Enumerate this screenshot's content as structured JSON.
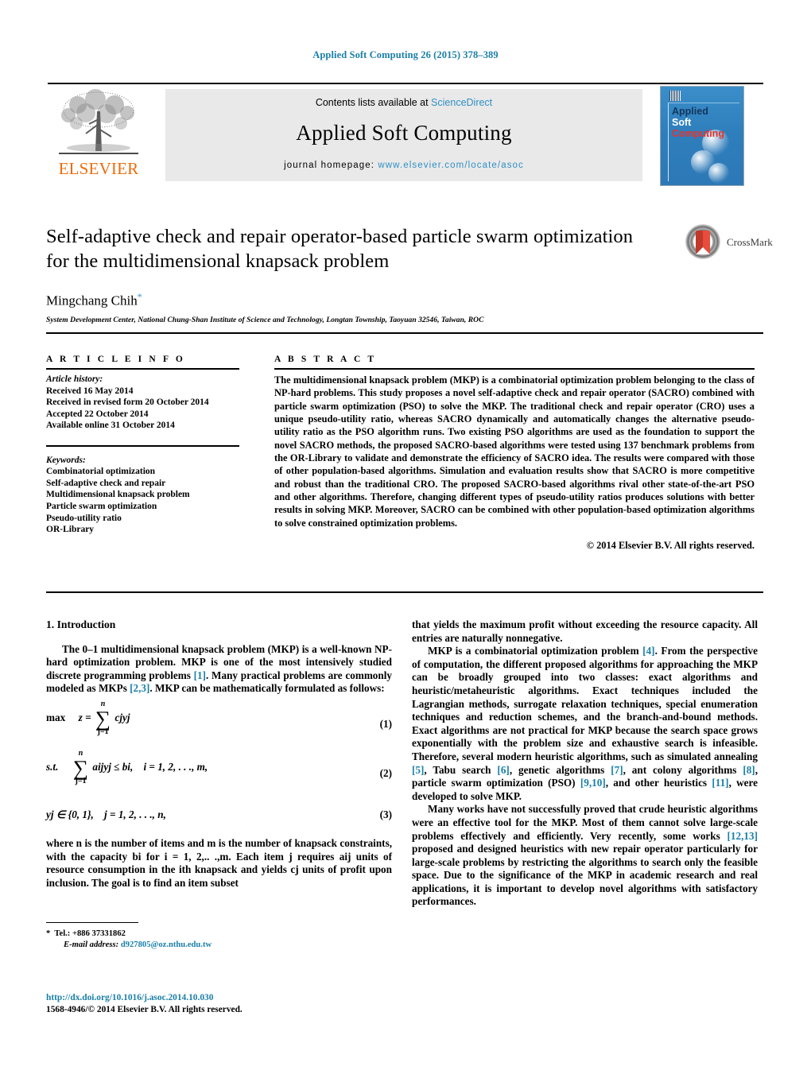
{
  "running_head": "Applied Soft Computing 26 (2015) 378–389",
  "masthead": {
    "publisher_name": "ELSEVIER",
    "contents_prefix": "Contents lists available at ",
    "contents_link": "ScienceDirect",
    "journal_title": "Applied Soft Computing",
    "homepage_prefix": "journal homepage:",
    "homepage_url": "www.elsevier.com/locate/asoc",
    "cover": {
      "line1": "Applied",
      "line2": "Soft",
      "line3": "Computing"
    }
  },
  "crossmark": {
    "label": "CrossMark"
  },
  "article": {
    "title": "Self-adaptive check and repair operator-based particle swarm optimization for the multidimensional knapsack problem",
    "author": "Mingchang Chih",
    "author_marker": "*",
    "affiliation": "System Development Center, National Chung-Shan Institute of Science and Technology, Longtan Township, Taoyuan 32546, Taiwan, ROC"
  },
  "article_info": {
    "heading": "A R T I C L E    I N F O",
    "history_label": "Article history:",
    "history": [
      "Received 16 May 2014",
      "Received in revised form 20 October 2014",
      "Accepted 22 October 2014",
      "Available online 31 October 2014"
    ],
    "keywords_label": "Keywords:",
    "keywords": [
      "Combinatorial optimization",
      "Self-adaptive check and repair",
      "Multidimensional knapsack problem",
      "Particle swarm optimization",
      "Pseudo-utility ratio",
      "OR-Library"
    ]
  },
  "abstract": {
    "heading": "A B S T R A C T",
    "body": "The multidimensional knapsack problem (MKP) is a combinatorial optimization problem belonging to the class of NP-hard problems. This study proposes a novel self-adaptive check and repair operator (SACRO) combined with particle swarm optimization (PSO) to solve the MKP. The traditional check and repair operator (CRO) uses a unique pseudo-utility ratio, whereas SACRO dynamically and automatically changes the alternative pseudo-utility ratio as the PSO algorithm runs. Two existing PSO algorithms are used as the foundation to support the novel SACRO methods, the proposed SACRO-based algorithms were tested using 137 benchmark problems from the OR-Library to validate and demonstrate the efficiency of SACRO idea. The results were compared with those of other population-based algorithms. Simulation and evaluation results show that SACRO is more competitive and robust than the traditional CRO. The proposed SACRO-based algorithms rival other state-of-the-art PSO and other algorithms. Therefore, changing different types of pseudo-utility ratios produces solutions with better results in solving MKP. Moreover, SACRO can be combined with other population-based optimization algorithms to solve constrained optimization problems.",
    "copyright": "© 2014 Elsevier B.V. All rights reserved."
  },
  "body": {
    "section_heading": "1.  Introduction",
    "left": {
      "para1_a": "The 0–1 multidimensional knapsack problem (MKP) is a well-known NP-hard optimization problem. MKP is one of the most intensively studied discrete programming problems ",
      "para1_ref1": "[1]",
      "para1_b": ". Many practical problems are commonly modeled as MKPs ",
      "para1_ref2": "[2,3]",
      "para1_c": ". MKP can be mathematically formulated as follows:",
      "eq1_label": "max",
      "eq1_lhs": "z =",
      "eq1_sum_top": "n",
      "eq1_sum_bot": "j=1",
      "eq1_rhs": "cjyj",
      "eq1_num": "(1)",
      "eq2_label": "s.t.",
      "eq2_sum_top": "n",
      "eq2_sum_bot": "j=1",
      "eq2_rhs": "aijyj ≤ bi,",
      "eq2_cond": "i = 1, 2, . . ., m,",
      "eq2_num": "(2)",
      "eq3_body": "yj ∈ {0, 1},",
      "eq3_cond": "j = 1, 2, . . ., n,",
      "eq3_num": "(3)",
      "para2": "where n is the number of items and m is the number of knapsack constraints, with the capacity bi for i = 1, 2,.. .,m. Each item j requires aij units of resource consumption in the ith knapsack and yields cj units of profit upon inclusion. The goal is to find an item subset"
    },
    "right": {
      "para1": "that yields the maximum profit without exceeding the resource capacity. All entries are naturally nonnegative.",
      "para2_a": "MKP is a combinatorial optimization problem ",
      "para2_ref": "[4]",
      "para2_b": ". From the perspective of computation, the different proposed algorithms for approaching the MKP can be broadly grouped into two classes: exact algorithms and heuristic/metaheuristic algorithms. Exact techniques included the Lagrangian methods, surrogate relaxation techniques, special enumeration techniques and reduction schemes, and the branch-and-bound methods. Exact algorithms are not practical for MKP because the search space grows exponentially with the problem size and exhaustive search is infeasible. Therefore, several modern heuristic algorithms, such as simulated annealing ",
      "para2_ref5": "[5]",
      "para2_c": ", Tabu search ",
      "para2_ref6": "[6]",
      "para2_d": ", genetic algorithms ",
      "para2_ref7": "[7]",
      "para2_e": ", ant colony algorithms ",
      "para2_ref8": "[8]",
      "para2_f": ", particle swarm optimization (PSO) ",
      "para2_ref910": "[9,10]",
      "para2_g": ", and other heuristics ",
      "para2_ref11": "[11]",
      "para2_h": ", were developed to solve MKP.",
      "para3_a": "Many works have not successfully proved that crude heuristic algorithms were an effective tool for the MKP. Most of them cannot solve large-scale problems effectively and efficiently. Very recently, some works ",
      "para3_ref": "[12,13]",
      "para3_b": " proposed and designed heuristics with new repair operator particularly for large-scale problems by restricting the algorithms to search only the feasible space. Due to the significance of the MKP in academic research and real applications, it is important to develop novel algorithms with satisfactory performances."
    }
  },
  "footnote": {
    "marker": "*",
    "tel": "Tel.: +886 37331862",
    "email_label": "E-mail address:",
    "email": "d927805@oz.nthu.edu.tw"
  },
  "imprint": {
    "doi": "http://dx.doi.org/10.1016/j.asoc.2014.10.030",
    "issn_line": "1568-4946/© 2014 Elsevier B.V. All rights reserved."
  },
  "colors": {
    "link": "#1a7fa8",
    "sciencedirect": "#2f8fc4",
    "elsevier_orange": "#eb6c0b",
    "cover_blue": "#2f7fbd",
    "cover_red": "#e8332a"
  }
}
